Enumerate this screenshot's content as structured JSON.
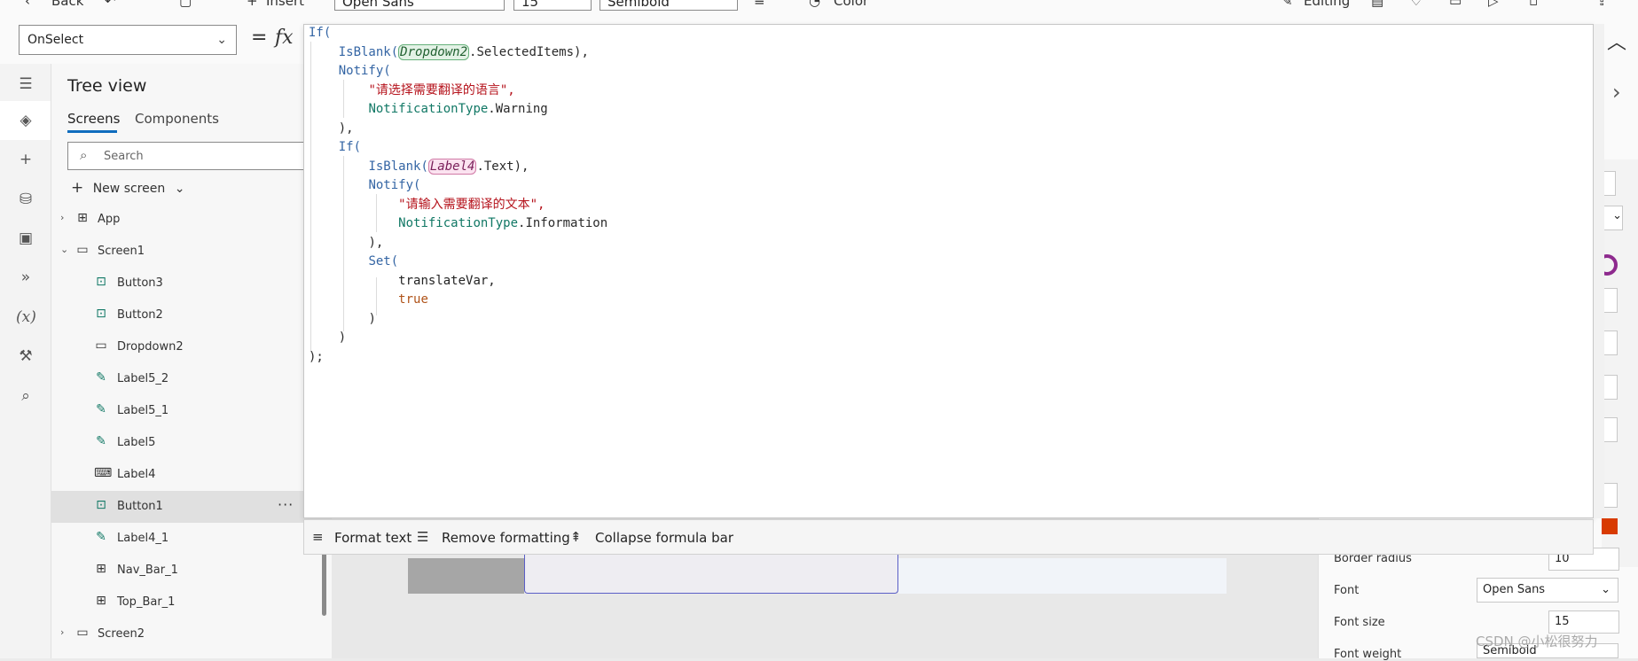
{
  "toolbar": {
    "back_label": "Back",
    "insert_label": "Insert",
    "font_value": "Open Sans",
    "size_value": "15",
    "weight_value": "Semibold",
    "color_label": "Color",
    "editing_label": "Editing"
  },
  "formula_bar": {
    "property": "OnSelect",
    "equals": "=",
    "fx": "fx",
    "format_text": "Format text",
    "remove_formatting": "Remove formatting",
    "collapse_formula_bar": "Collapse formula bar"
  },
  "tree": {
    "title": "Tree view",
    "tabs": [
      "Screens",
      "Components"
    ],
    "search_placeholder": "Search",
    "new_screen": "New screen",
    "items": [
      {
        "label": "App"
      },
      {
        "label": "Screen1"
      },
      {
        "label": "Button3"
      },
      {
        "label": "Button2"
      },
      {
        "label": "Dropdown2"
      },
      {
        "label": "Label5_2"
      },
      {
        "label": "Label5_1"
      },
      {
        "label": "Label5"
      },
      {
        "label": "Label4"
      },
      {
        "label": "Button1"
      },
      {
        "label": "Label4_1"
      },
      {
        "label": "Nav_Bar_1"
      },
      {
        "label": "Top_Bar_1"
      },
      {
        "label": "Screen2"
      }
    ],
    "more": "···"
  },
  "code": {
    "if1": "If(",
    "isblank1": "IsBlank(",
    "dropdown": "Dropdown2",
    "selected": ".SelectedItems),",
    "notify1": "Notify(",
    "msg1": "\"请选择需要翻译的语言\",",
    "warn_type": "NotificationType",
    "warn": ".Warning",
    "close1": "),",
    "if2": "If(",
    "isblank2": "IsBlank(",
    "label4": "Label4",
    "text": ".Text),",
    "notify2": "Notify(",
    "msg2": "\"请输入需要翻译的文本\",",
    "info_type": "NotificationType",
    "info": ".Information",
    "close2": "),",
    "set": "Set(",
    "var": "translateVar,",
    "truev": "true",
    "close3": ")",
    "close4": ")",
    "close5": ");"
  },
  "properties": {
    "border_radius_label": "Border radius",
    "border_radius_value": "10",
    "font_label": "Font",
    "font_value": "Open Sans",
    "font_size_label": "Font size",
    "font_size_value": "15",
    "font_weight_label": "Font weight",
    "font_weight_value": "Semibold",
    "accent": "#d83b01"
  },
  "watermark": "CSDN @小松很努力"
}
